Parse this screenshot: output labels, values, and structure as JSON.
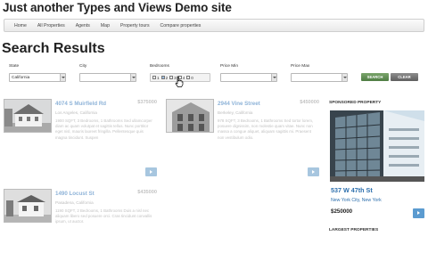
{
  "site": {
    "title": "Just another Types and Views Demo site"
  },
  "nav": {
    "items": [
      "Home",
      "All Properties",
      "Agents",
      "Map",
      "Property tours",
      "Compare properties"
    ]
  },
  "page": {
    "title": "Search Results"
  },
  "filters": {
    "state_label": "State",
    "state_value": "California",
    "city_label": "City",
    "city_value": "",
    "bedrooms_label": "Bedrooms",
    "bedrooms_options": [
      "1",
      "2",
      "3",
      "4",
      "0"
    ],
    "bedrooms_checked": [
      "2"
    ],
    "price_min_label": "Price Min",
    "price_min_value": "",
    "price_max_label": "Price Max",
    "price_max_value": "",
    "search_label": "SEARCH",
    "clear_label": "CLEAR"
  },
  "results": [
    {
      "title": "4074 S Muirfield Rd",
      "price": "$375000",
      "location": "Los Angeles, California",
      "description": "1900 SQFT, 3 Bedrooms, 1 Bathrooms Sed ullamcorper diam ac quam volutpat et sagittis tellus. Nunc porttitor eget nisl, mauris laoreet fringilla. Pellentesque quis magna tincidunt. Suspen"
    },
    {
      "title": "2944 Vine Street",
      "price": "$450000",
      "location": "Berkeley, California",
      "description": "978 SQFT, 3 Bedrooms, 1 Bathrooms Sed tortor lorem, posuere dignissim, non molestie quam vitae. Nunc non massa a congue aliquet, aliquam sagittis mi. Praesent non vestibulum odio."
    },
    {
      "title": "1490 Locust St",
      "price": "$435000",
      "location": "Pasadena, California",
      "description": "1190 SQFT, 2 Bedrooms, 1 Bathrooms Duis a nisl nec aliquam libero sed posuere orci. Cras tincidunt convallis ipsum, ut auctor."
    }
  ],
  "sidebar": {
    "sponsored_heading": "SPONSORED PROPERTY",
    "sponsored_address": "537 W 47th St",
    "sponsored_city": "New York City, New York",
    "sponsored_price": "$250000",
    "largest_heading": "LARGEST PROPERTIES"
  },
  "colors": {
    "accent": "#2d6fad",
    "search_button": "#5b8a4f",
    "clear_button": "#6d6d6d"
  }
}
